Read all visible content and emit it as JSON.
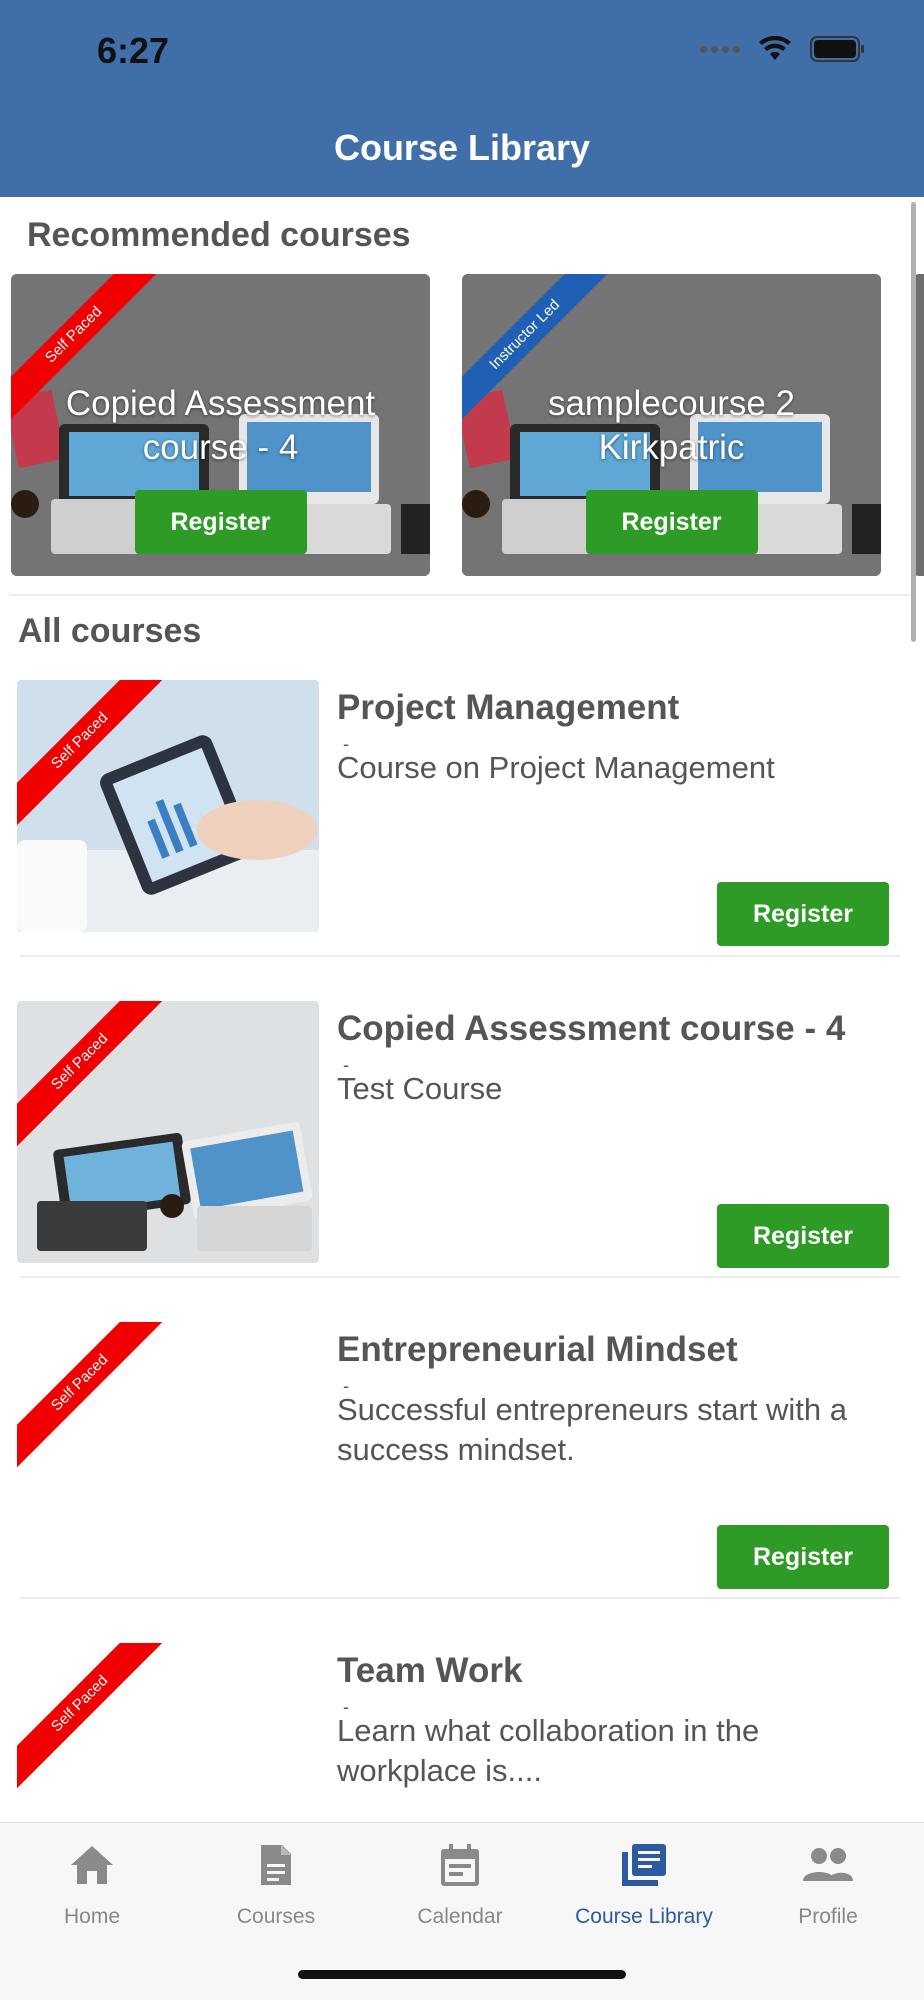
{
  "status_bar": {
    "time": "6:27"
  },
  "header": {
    "title": "Course Library"
  },
  "recommended": {
    "heading": "Recommended courses",
    "cards": [
      {
        "title": "Copied Assessment course - 4",
        "ribbon": "Self Paced",
        "button": "Register"
      },
      {
        "title": "samplecourse 2 Kirkpatric",
        "ribbon": "Instructor Led",
        "button": "Register"
      }
    ]
  },
  "all_courses": {
    "heading": "All courses",
    "items": [
      {
        "title": "Project Management",
        "dash": "-",
        "description": "Course on Project Management",
        "ribbon": "Self Paced",
        "button": "Register"
      },
      {
        "title": "Copied Assessment course - 4",
        "dash": "-",
        "description": "Test Course",
        "ribbon": "Self Paced",
        "button": "Register"
      },
      {
        "title": "Entrepreneurial Mindset",
        "dash": "-",
        "description": "Successful entrepreneurs start with a success mindset.",
        "ribbon": "Self Paced",
        "button": "Register"
      },
      {
        "title": "Team Work",
        "dash": "-",
        "description": "Learn what collaboration in the workplace is....",
        "ribbon": "Self Paced"
      }
    ]
  },
  "tabbar": {
    "active": "Course Library",
    "tabs": [
      {
        "label": "Home",
        "icon": "home-icon"
      },
      {
        "label": "Courses",
        "icon": "document-icon"
      },
      {
        "label": "Calendar",
        "icon": "calendar-icon"
      },
      {
        "label": "Course Library",
        "icon": "library-icon"
      },
      {
        "label": "Profile",
        "icon": "people-icon"
      }
    ]
  },
  "colors": {
    "header": "#3f6ea9",
    "button": "#2e9b26",
    "ribbon_self_paced": "#f00000",
    "ribbon_instructor_led": "#1f5fb5",
    "active_tab": "#2b5aa0"
  }
}
